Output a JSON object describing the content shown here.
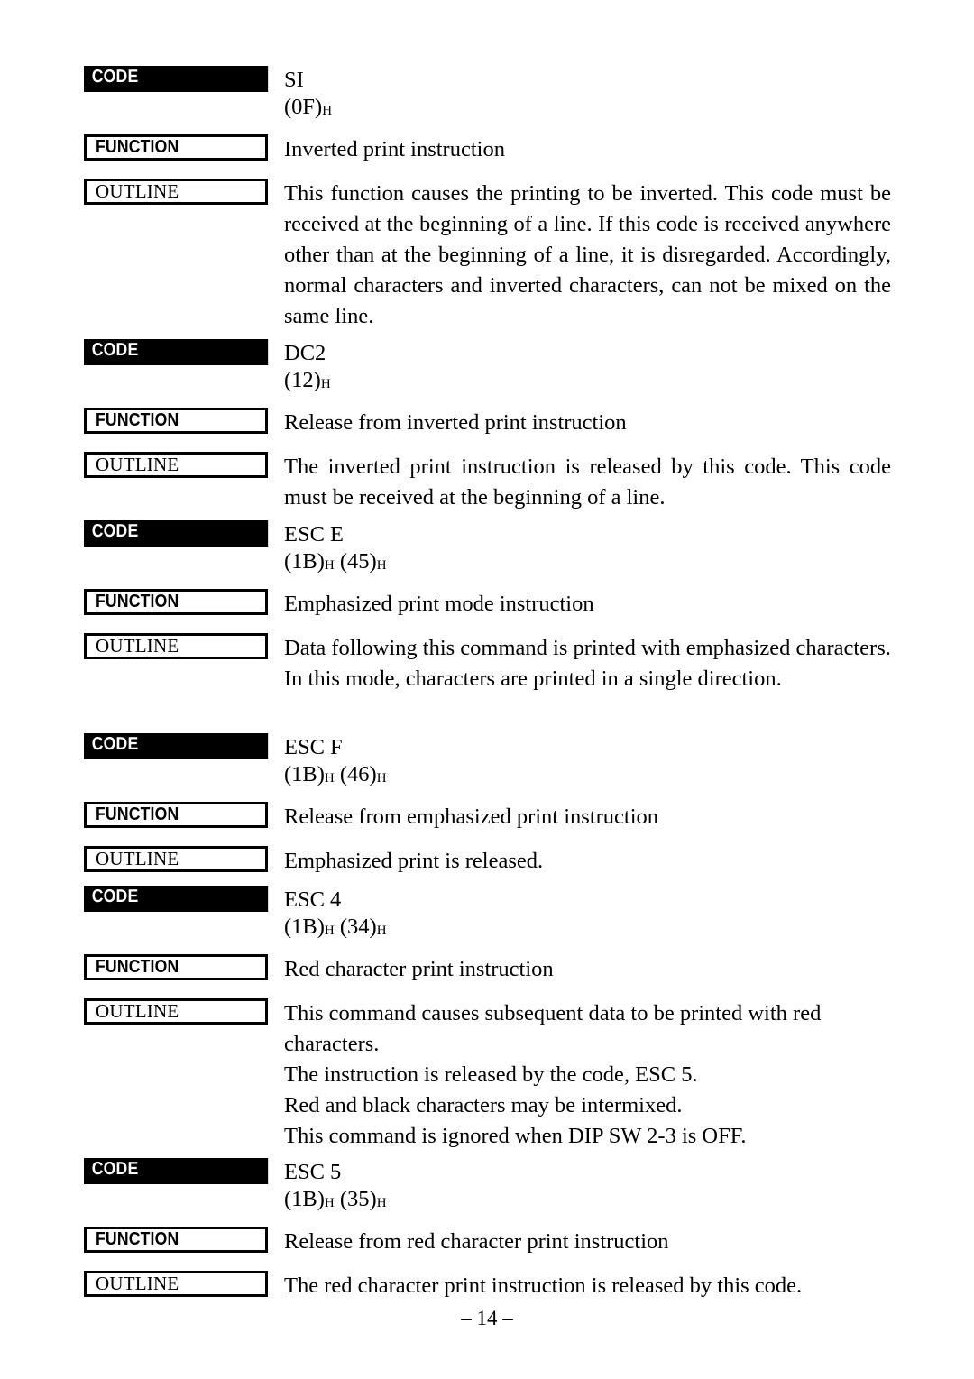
{
  "document": {
    "page_number": "– 14 –",
    "labels": {
      "code": "CODE",
      "function": "FUNCTION",
      "outline": "OUTLINE"
    }
  },
  "sections": [
    {
      "id": "si",
      "code_name": "SI",
      "code_hex": "(0F)",
      "hex_suffix": "H",
      "function": "Inverted print instruction",
      "outline_lines": [
        "This function causes the printing to be inverted. This code must be received at the beginning of a line. If this code is received anywhere other than at the beginning of a line, it is disregarded. Accordingly, normal characters and inverted characters, can not be mixed on the same line."
      ]
    },
    {
      "id": "dc2",
      "code_name": "DC2",
      "code_hex": "(12)",
      "hex_suffix": "H",
      "function": "Release from inverted print instruction",
      "outline_lines": [
        "The inverted print instruction is released by this code. This code must be received at the beginning of a line."
      ]
    },
    {
      "id": "esc-e",
      "code_name": "ESC E",
      "code_hex": "(1B)",
      "hex_suffix": "H",
      "code_hex2": "(45)",
      "hex_suffix2": "H",
      "function": "Emphasized print mode instruction",
      "outline_lines": [
        "Data following this command is printed with emphasized characters.",
        "In this mode, characters are printed in a single direction."
      ]
    },
    {
      "id": "esc-f",
      "code_name": "ESC F",
      "code_hex": "(1B)",
      "hex_suffix": "H",
      "code_hex2": "(46)",
      "hex_suffix2": "H",
      "function": "Release from emphasized print instruction",
      "outline_lines": [
        "Emphasized print is released."
      ]
    },
    {
      "id": "esc-4",
      "code_name": "ESC 4",
      "code_hex": "(1B)",
      "hex_suffix": "H",
      "code_hex2": "(34)",
      "hex_suffix2": "H",
      "function": "Red character print instruction",
      "outline_lines": [
        "This command causes subsequent data to be printed with red characters.",
        "The instruction is released by the code, ESC 5.",
        "Red and black characters may be intermixed.",
        "This command is ignored when DIP SW 2-3 is OFF."
      ]
    },
    {
      "id": "esc-5",
      "code_name": "ESC 5",
      "code_hex": "(1B)",
      "hex_suffix": "H",
      "code_hex2": "(35)",
      "hex_suffix2": "H",
      "function": "Release from red character print instruction",
      "outline_lines": [
        "The red character print instruction is released by this code."
      ]
    }
  ]
}
